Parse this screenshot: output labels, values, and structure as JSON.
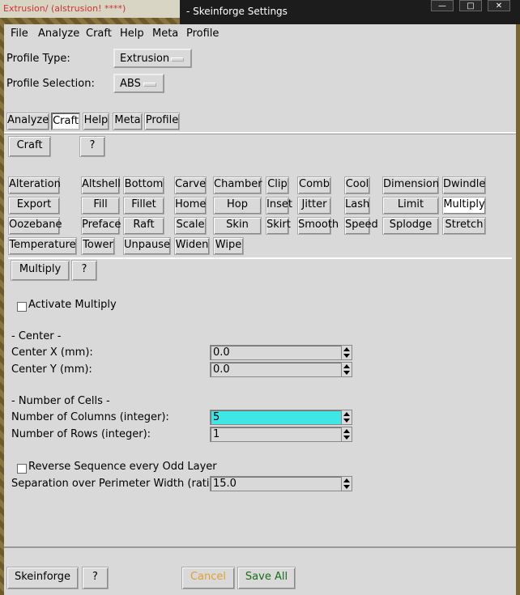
{
  "background": {
    "snippet": "Extrusion/ (alstrusion! ****)"
  },
  "window": {
    "title": "- Skeinforge Settings",
    "minimize": "—",
    "maximize": "□",
    "close": "✕"
  },
  "menubar": {
    "items": [
      {
        "label": "File"
      },
      {
        "label": "Analyze"
      },
      {
        "label": "Craft"
      },
      {
        "label": "Help"
      },
      {
        "label": "Meta"
      },
      {
        "label": "Profile"
      }
    ]
  },
  "profile": {
    "type_label": "Profile Type:",
    "type_value": "Extrusion",
    "selection_label": "Profile Selection:",
    "selection_value": "ABS"
  },
  "tabs": [
    "Analyze",
    "Craft",
    "Help",
    "Meta",
    "Profile"
  ],
  "craft_row": {
    "craft": "Craft",
    "help": "?"
  },
  "plugins": [
    "Alteration",
    "Altshell",
    "Bottom",
    "Carve",
    "Chamber",
    "Clip",
    "Comb",
    "Cool",
    "Dimension",
    "Dwindle",
    "Export",
    "Fill",
    "Fillet",
    "Home",
    "Hop",
    "Inset",
    "Jitter",
    "Lash",
    "Limit",
    "Multiply",
    "Oozebane",
    "Preface",
    "Raft",
    "Scale",
    "Skin",
    "Skirt",
    "Smooth",
    "Speed",
    "Splodge",
    "Stretch",
    "Temperature",
    "Tower",
    "Unpause",
    "Widen",
    "Wipe"
  ],
  "multiply": {
    "title_button": "Multiply",
    "help": "?",
    "activate_label": "Activate Multiply",
    "center_header": "- Center -",
    "center_x_label": "Center X (mm):",
    "center_x_value": "0.0",
    "center_y_label": "Center Y (mm):",
    "center_y_value": "0.0",
    "cells_header": "- Number of Cells -",
    "columns_label": "Number of Columns (integer):",
    "columns_value": "5",
    "rows_label": "Number of Rows (integer):",
    "rows_value": "1",
    "reverse_label": "Reverse Sequence every Odd Layer",
    "separation_label": "Separation over Perimeter Width (ratio):",
    "separation_value": "15.0"
  },
  "footer": {
    "skeinforge": "Skeinforge",
    "help": "?",
    "cancel": "Cancel",
    "save_all": "Save All"
  },
  "colors": {
    "focus": "#3fe6e6",
    "cancel": "#e0a030",
    "save_all": "#1a6b1a"
  }
}
